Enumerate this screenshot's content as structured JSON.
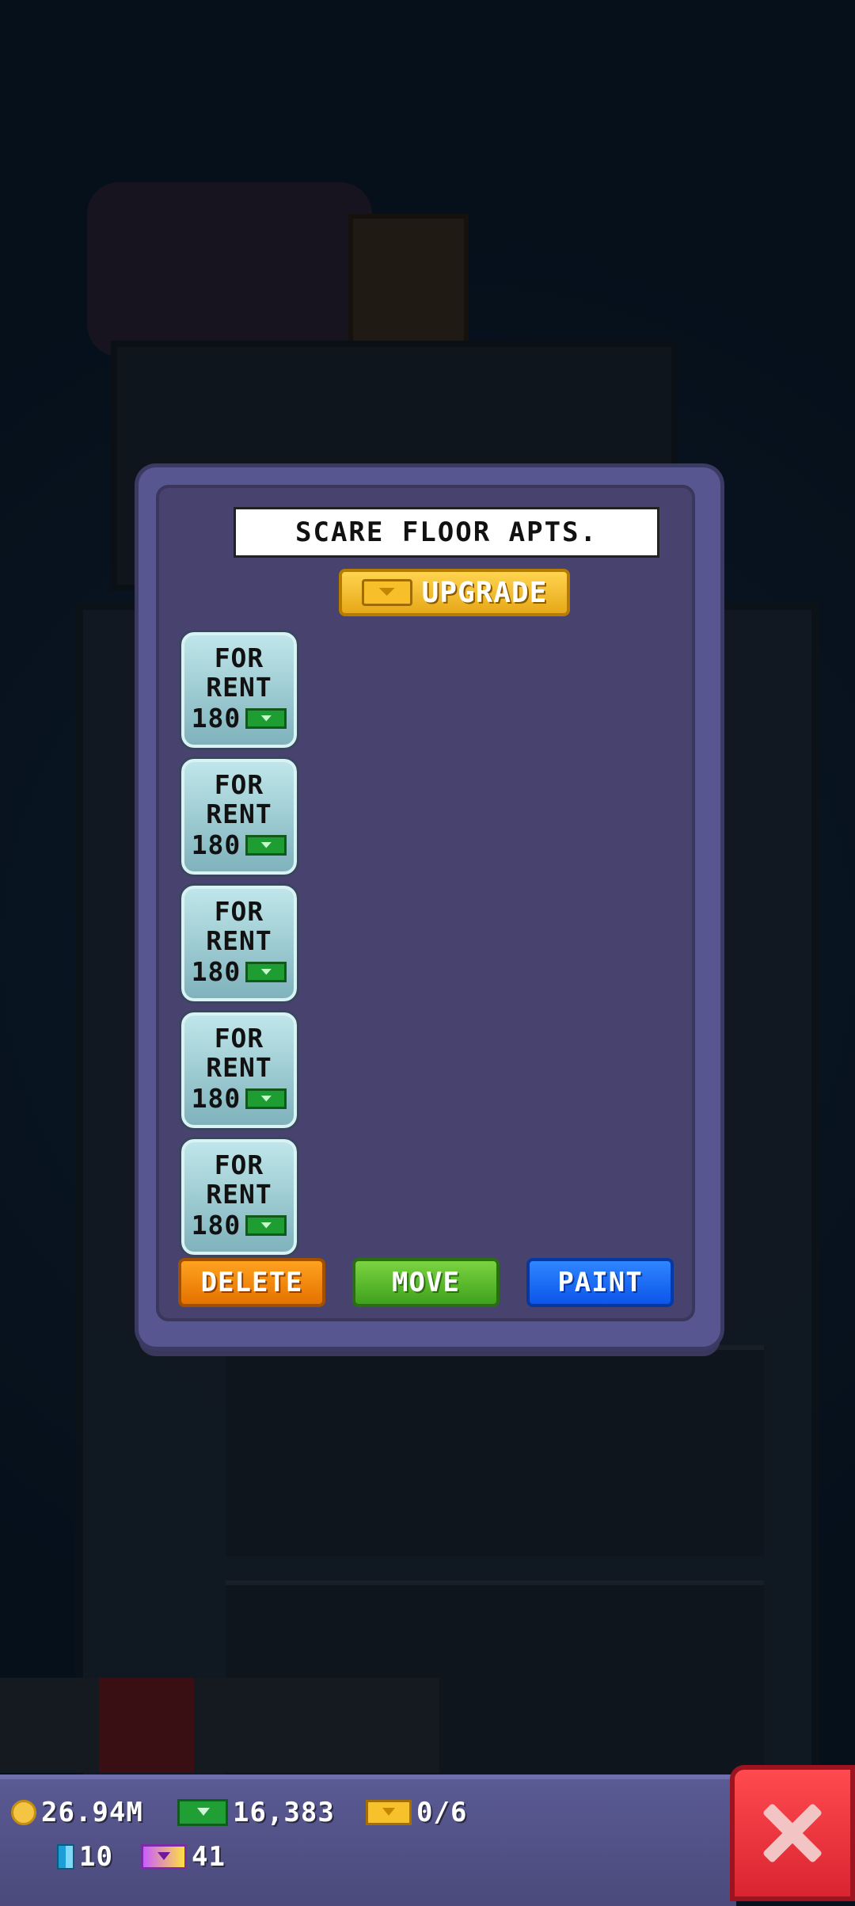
{
  "dialog": {
    "title": "SCARE FLOOR APTS.",
    "upgrade_label": "UPGRADE",
    "apartments": [
      {
        "line1": "FOR",
        "line2": "RENT",
        "price": "180"
      },
      {
        "line1": "FOR",
        "line2": "RENT",
        "price": "180"
      },
      {
        "line1": "FOR",
        "line2": "RENT",
        "price": "180"
      },
      {
        "line1": "FOR",
        "line2": "RENT",
        "price": "180"
      },
      {
        "line1": "FOR",
        "line2": "RENT",
        "price": "180"
      }
    ],
    "buttons": {
      "delete": "DELETE",
      "move": "MOVE",
      "paint": "PAINT"
    }
  },
  "status": {
    "coins": "26.94M",
    "bux": "16,383",
    "golden_tickets": "0/6",
    "canisters": "10",
    "vip": "41"
  },
  "icons": {
    "upgrade": "golden-ticket-icon",
    "rent": "bux-icon",
    "coins": "coin-icon",
    "bux": "bux-icon",
    "tickets": "golden-ticket-icon",
    "canisters": "canister-icon",
    "vip": "vip-ticket-icon",
    "close": "close-icon"
  }
}
